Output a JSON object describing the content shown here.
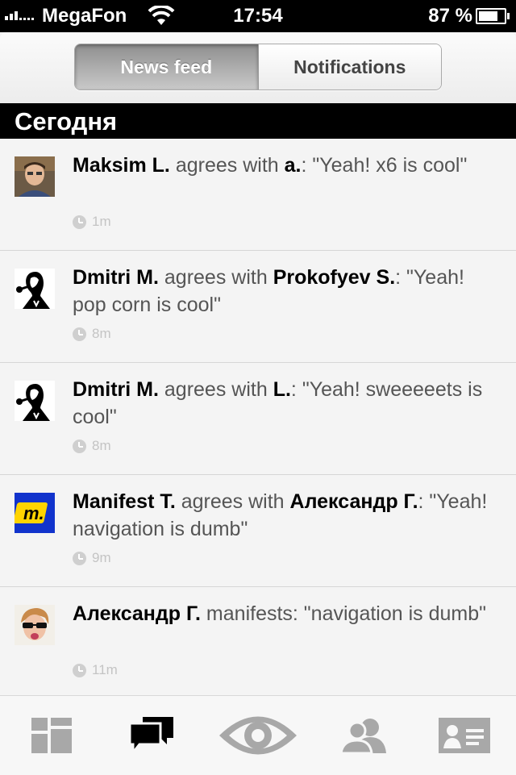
{
  "status_bar": {
    "carrier": "MegaFon",
    "time": "17:54",
    "battery_percent": "87 %",
    "battery_level": 0.87
  },
  "header": {
    "tabs": [
      {
        "label": "News feed",
        "active": true
      },
      {
        "label": "Notifications",
        "active": false
      }
    ]
  },
  "section": {
    "title": "Сегодня"
  },
  "feed": [
    {
      "user": "Maksim L.",
      "verb": " agrees with ",
      "target": "a.",
      "quote": ": \"Yeah! x6 is cool\"",
      "time": "1m",
      "avatar": "photo-avatar"
    },
    {
      "user": "Dmitri M.",
      "verb": " agrees with ",
      "target": "Prokofyev S.",
      "quote": ": \"Yeah! pop corn is cool\"",
      "time": "8m",
      "avatar": "silhouette-avatar"
    },
    {
      "user": "Dmitri M.",
      "verb": " agrees with ",
      "target": "L.",
      "quote": ": \"Yeah! sweeeeets is cool\"",
      "time": "8m",
      "avatar": "silhouette-avatar"
    },
    {
      "user": "Manifest T.",
      "verb": " agrees with ",
      "target": "Александр Г.",
      "quote": ": \"Yeah! navigation is dumb\"",
      "time": "9m",
      "avatar": "logo-avatar"
    },
    {
      "user": "Александр Г.",
      "verb": " manifests: \"navigation is dumb\"",
      "target": "",
      "quote": "",
      "time": "11m",
      "avatar": "photo-avatar"
    }
  ],
  "tab_bar": {
    "items": [
      {
        "icon": "dashboard-icon",
        "active": false
      },
      {
        "icon": "chat-bubbles-icon",
        "active": true
      },
      {
        "icon": "eye-icon",
        "active": false
      },
      {
        "icon": "people-icon",
        "active": false
      },
      {
        "icon": "profile-card-icon",
        "active": false
      }
    ]
  },
  "colors": {
    "active_tab": "#000000",
    "inactive_tab": "#a8a8a8",
    "section_bg": "#000000"
  }
}
